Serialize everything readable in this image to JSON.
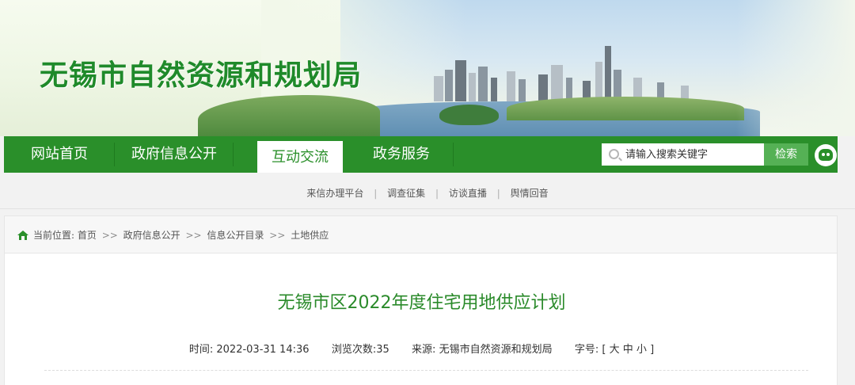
{
  "site": {
    "title": "无锡市自然资源和规划局"
  },
  "nav": {
    "items": [
      {
        "label": "网站首页"
      },
      {
        "label": "政府信息公开"
      },
      {
        "label": "互动交流"
      },
      {
        "label": "政务服务"
      }
    ],
    "search_placeholder": "请输入搜索关键字",
    "search_button": "检索",
    "icon": "robot-assistant-icon",
    "colors": {
      "primary": "#2a8f2a",
      "search_button": "#55b155",
      "title": "#1f8a2a"
    }
  },
  "subnav": {
    "items": [
      {
        "label": "来信办理平台"
      },
      {
        "label": "调查征集"
      },
      {
        "label": "访谈直播"
      },
      {
        "label": "舆情回音"
      }
    ],
    "separator": "|"
  },
  "breadcrumb": {
    "icon": "home-icon",
    "prefix": "当前位置:",
    "items": [
      "首页",
      "政府信息公开",
      "信息公开目录",
      "土地供应"
    ],
    "separator": ">>"
  },
  "article": {
    "title": "无锡市区2022年度住宅用地供应计划",
    "time_label": "时间:",
    "time_value": "2022-03-31 14:36",
    "views": "浏览次数:35",
    "source_label": "来源:",
    "source_value": "无锡市自然资源和规划局",
    "font_size_label": "字号:",
    "font_size_open": "[",
    "font_size_options": [
      "大",
      "中",
      "小"
    ],
    "font_size_close": "]"
  }
}
